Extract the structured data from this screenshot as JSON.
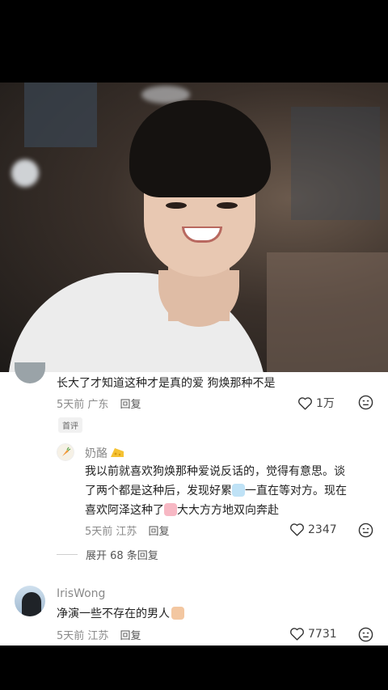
{
  "comments": {
    "c1": {
      "text": "长大了才知道这种才是真的爱 狗焕那种不是",
      "time_loc": "5天前 广东",
      "reply_label": "回复",
      "likes": "1万",
      "badge": "首评"
    },
    "reply1": {
      "username": "奶酪",
      "text_line1": "我以前就喜欢狗焕那种爱说反话的，觉得有意思。谈",
      "text_line2a": "了两个都是这种后，发现好累",
      "text_line2b": "一直在等对方。现在",
      "text_line3a": "喜欢阿泽这种了",
      "text_line3b": "大大方方地双向奔赴",
      "time_loc": "5天前 江苏",
      "reply_label": "回复",
      "likes": "2347",
      "expand_label": "展开 68 条回复"
    },
    "c2": {
      "username": "IrisWong",
      "text": "净演一些不存在的男人",
      "time_loc": "5天前 江苏",
      "reply_label": "回复",
      "likes": "7731"
    }
  },
  "icons": {
    "like": "heart-outline-icon",
    "dislike": "dislike-face-icon"
  },
  "colors": {
    "panel_bg": "#ffffff",
    "text": "#222222",
    "muted": "#8a8a8a"
  }
}
